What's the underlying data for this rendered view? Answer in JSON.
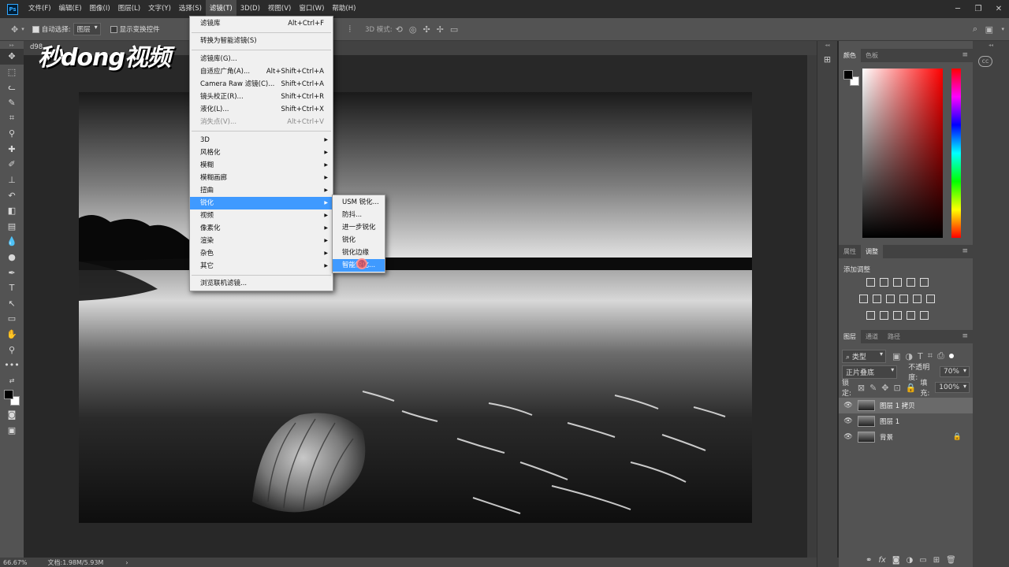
{
  "menubar": {
    "items": [
      "文件(F)",
      "编辑(E)",
      "图像(I)",
      "图层(L)",
      "文字(Y)",
      "选择(S)",
      "滤镜(T)",
      "3D(D)",
      "视图(V)",
      "窗口(W)",
      "帮助(H)"
    ]
  },
  "options": {
    "auto_select": "自动选择:",
    "layer_select": "图层",
    "show_transform": "显示变换控件",
    "mode_3d": "3D 模式:"
  },
  "document": {
    "tab": "d98...",
    "zoom": "66.67%",
    "doc_info": "文档:1.98M/5.93M"
  },
  "watermark": "秒dong视频",
  "filter_menu": {
    "items": [
      {
        "label": "滤镜库",
        "shortcut": "Alt+Ctrl+F"
      },
      {
        "label": "转换为智能滤镜(S)",
        "shortcut": ""
      },
      {
        "label": "滤镜库(G)...",
        "shortcut": ""
      },
      {
        "label": "自适应广角(A)...",
        "shortcut": "Alt+Shift+Ctrl+A"
      },
      {
        "label": "Camera Raw 滤镜(C)...",
        "shortcut": "Shift+Ctrl+A"
      },
      {
        "label": "镜头校正(R)...",
        "shortcut": "Shift+Ctrl+R"
      },
      {
        "label": "液化(L)...",
        "shortcut": "Shift+Ctrl+X"
      },
      {
        "label": "消失点(V)...",
        "shortcut": "Alt+Ctrl+V"
      },
      {
        "label": "3D"
      },
      {
        "label": "风格化"
      },
      {
        "label": "模糊"
      },
      {
        "label": "模糊画廊"
      },
      {
        "label": "扭曲"
      },
      {
        "label": "锐化"
      },
      {
        "label": "视频"
      },
      {
        "label": "像素化"
      },
      {
        "label": "渲染"
      },
      {
        "label": "杂色"
      },
      {
        "label": "其它"
      },
      {
        "label": "浏览联机滤镜..."
      }
    ]
  },
  "sharpen_submenu": {
    "items": [
      "USM 锐化...",
      "防抖...",
      "进一步锐化",
      "锐化",
      "锐化边缘",
      "智能锐化..."
    ]
  },
  "panels": {
    "color_tabs": [
      "颜色",
      "色板"
    ],
    "adjust_tabs": [
      "属性",
      "调整"
    ],
    "add_adjustment": "添加调整",
    "layers_tabs": [
      "图层",
      "通道",
      "路径"
    ],
    "filter_kind": "类型",
    "blend_mode": "正片叠底",
    "opacity_label": "不透明度:",
    "opacity_value": "70%",
    "lock_label": "锁定:",
    "fill_label": "填充:",
    "fill_value": "100%",
    "layers": [
      "图层 1 拷贝",
      "图层 1",
      "背景"
    ]
  }
}
